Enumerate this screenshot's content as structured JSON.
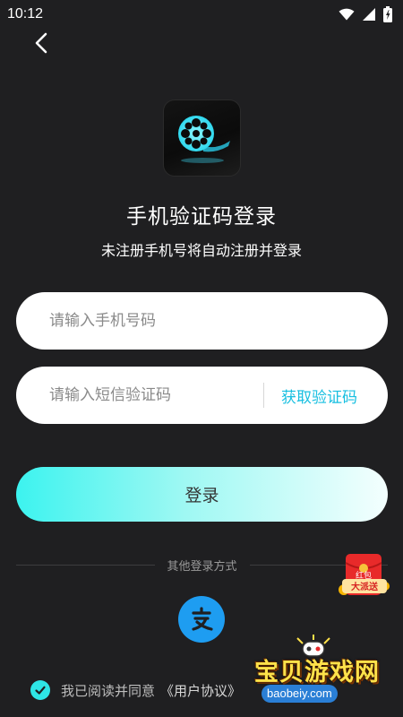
{
  "status_bar": {
    "time": "10:12",
    "icons": [
      "wifi-icon",
      "signal-icon",
      "battery-icon"
    ]
  },
  "header": {
    "back_icon": "chevron-left-icon"
  },
  "app": {
    "logo_icon": "film-reel-icon"
  },
  "login": {
    "title": "手机验证码登录",
    "subtitle": "未注册手机号将自动注册并登录",
    "phone_placeholder": "请输入手机号码",
    "phone_value": "",
    "code_placeholder": "请输入短信验证码",
    "code_value": "",
    "get_code_label": "获取验证码",
    "login_button": "登录",
    "other_methods_label": "其他登录方式",
    "alipay_icon": "alipay-icon"
  },
  "agreement": {
    "checked": true,
    "text": "我已阅读并同意",
    "link_text": "《用户协议》"
  },
  "overlays": {
    "redpacket_text_top": "红包",
    "redpacket_text_bottom": "大派送",
    "watermark_title": "宝贝游戏网",
    "watermark_url": "baobeiy.com"
  },
  "colors": {
    "background": "#1f1f21",
    "accent": "#17bfe0",
    "button_gradient_start": "#3cf3ef",
    "button_gradient_end": "#f4fffe",
    "alipay_blue": "#1e9df1"
  }
}
